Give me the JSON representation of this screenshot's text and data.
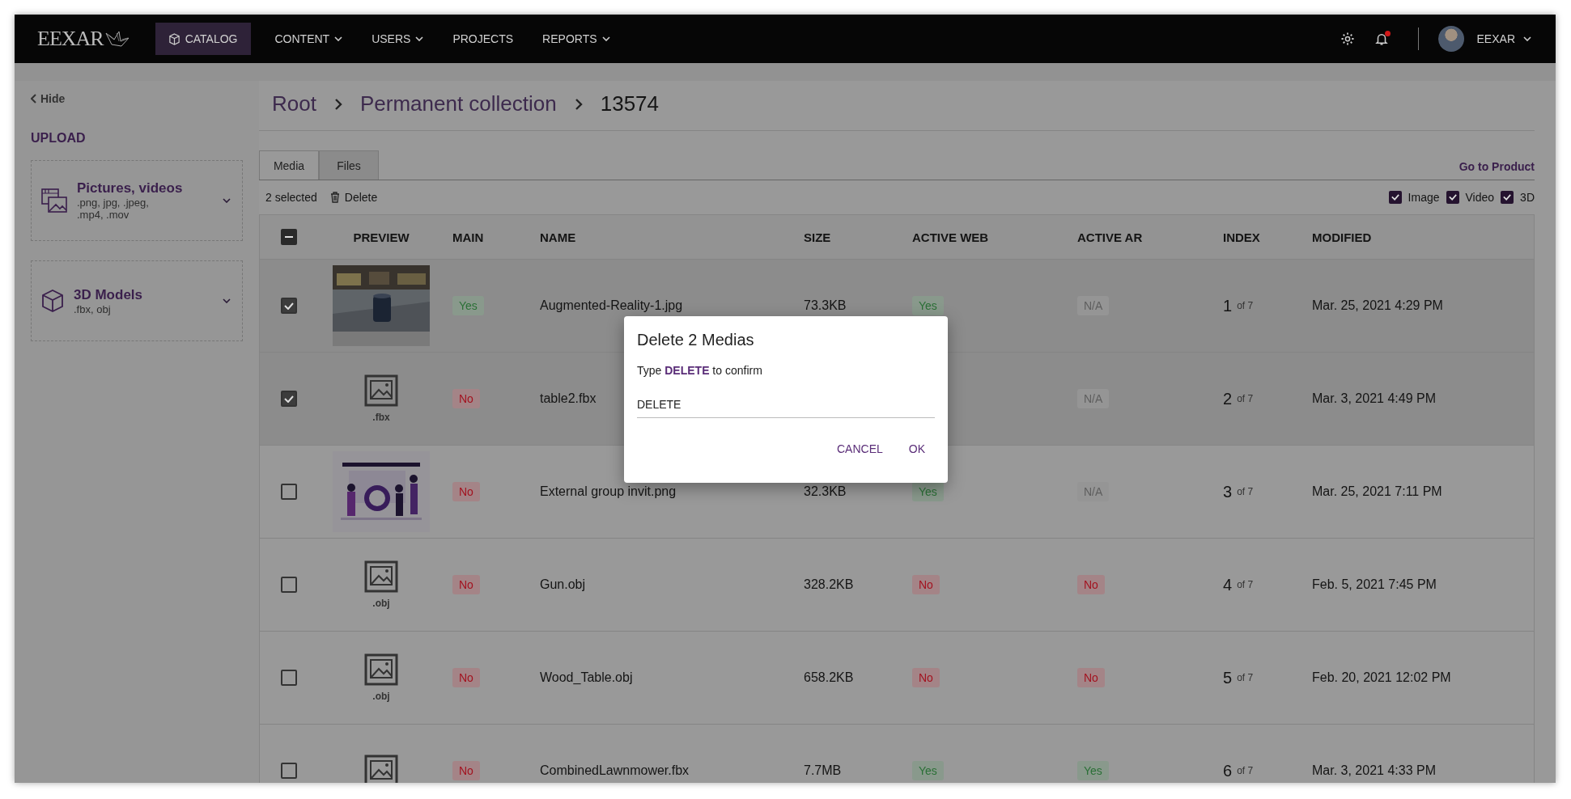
{
  "header": {
    "logo": "EEXAR",
    "nav": [
      {
        "label": "CATALOG",
        "selected": true,
        "has_menu": false
      },
      {
        "label": "CONTENT",
        "selected": false,
        "has_menu": true
      },
      {
        "label": "USERS",
        "selected": false,
        "has_menu": true
      },
      {
        "label": "PROJECTS",
        "selected": false,
        "has_menu": false
      },
      {
        "label": "REPORTS",
        "selected": false,
        "has_menu": true
      }
    ],
    "notification_dot": true,
    "user": "EEXAR"
  },
  "sidebar": {
    "hide": "Hide",
    "title": "UPLOAD",
    "uploads": [
      {
        "kind": "media",
        "title": "Pictures, videos",
        "formats": ".png, jpg, .jpeg, .mp4, .mov"
      },
      {
        "kind": "model",
        "title": "3D Models",
        "formats": ".fbx, obj"
      }
    ]
  },
  "breadcrumb": [
    "Root",
    "Permanent collection",
    "13574"
  ],
  "tabs": [
    {
      "label": "Media",
      "selected": true
    },
    {
      "label": "Files",
      "selected": false
    }
  ],
  "go_to_product": "Go to Product",
  "toolbar": {
    "selected_count": "2 selected",
    "delete": "Delete",
    "filters": [
      {
        "label": "Image",
        "checked": true
      },
      {
        "label": "Video",
        "checked": true
      },
      {
        "label": "3D",
        "checked": true
      }
    ]
  },
  "table": {
    "select_all_partial": true,
    "columns": [
      "PREVIEW",
      "MAIN",
      "NAME",
      "SIZE",
      "ACTIVE WEB",
      "ACTIVE AR",
      "INDEX",
      "MODIFIED"
    ],
    "rows": [
      {
        "selected": true,
        "main": {
          "label": "Yes",
          "color": "#2a7036"
        },
        "name": "Augmented-Reality-1.jpg",
        "size": "73.3KB",
        "active_web": {
          "label": "Yes",
          "color": "#2a7036"
        },
        "active_ar": {
          "label": "N/A",
          "color": "#5e5e5e"
        },
        "index": "1",
        "index_total": "of 7",
        "modified": "Mar. 25, 2021 4:29 PM"
      },
      {
        "selected": true,
        "preview": {
          "kind": "file",
          "ext": ".fbx"
        },
        "main": {
          "label": "No",
          "color": "#a3121f"
        },
        "name": "table2.fbx",
        "active_ar": {
          "label": "N/A",
          "color": "#5e5e5e"
        },
        "index": "2",
        "index_total": "of 7",
        "modified": "Mar. 3, 2021 4:49 PM"
      },
      {
        "selected": false,
        "preview": {
          "kind": "illustration"
        },
        "main": {
          "label": "No",
          "color": "#a3121f"
        },
        "name": "External group invit.png",
        "size": "32.3KB",
        "active_web": {
          "label": "Yes",
          "color": "#2a7036"
        },
        "active_ar": {
          "label": "N/A",
          "color": "#5e5e5e"
        },
        "index": "3",
        "index_total": "of 7",
        "modified": "Mar. 25, 2021 7:11 PM"
      },
      {
        "selected": false,
        "preview": {
          "kind": "file",
          "ext": ".obj"
        },
        "main": {
          "label": "No",
          "color": "#a3121f"
        },
        "name": "Gun.obj",
        "size": "328.2KB",
        "active_web": {
          "label": "No",
          "color": "#a3121f"
        },
        "active_ar": {
          "label": "No",
          "color": "#a3121f"
        },
        "index": "4",
        "index_total": "of 7",
        "modified": "Feb. 5, 2021 7:45 PM"
      },
      {
        "selected": false,
        "preview": {
          "kind": "file",
          "ext": ".obj"
        },
        "main": {
          "label": "No",
          "color": "#a3121f"
        },
        "name": "Wood_Table.obj",
        "size": "658.2KB",
        "active_web": {
          "label": "No",
          "color": "#a3121f"
        },
        "active_ar": {
          "label": "No",
          "color": "#a3121f"
        },
        "index": "5",
        "index_total": "of 7",
        "modified": "Feb. 20, 2021 12:02 PM"
      },
      {
        "selected": false,
        "preview": {
          "kind": "file"
        },
        "main": {
          "label": "No",
          "color": "#a3121f"
        },
        "name": "CombinedLawnmower.fbx",
        "size": "7.7MB",
        "active_web": {
          "label": "Yes",
          "color": "#2a7036"
        },
        "active_ar": {
          "label": "Yes",
          "color": "#2a7036"
        },
        "index": "6",
        "index_total": "of 7",
        "modified": "Mar. 3, 2021 4:33 PM"
      }
    ]
  },
  "dialog": {
    "title": "Delete 2 Medias",
    "instruction": "Type **DELETE** to confirm",
    "value": "DELETE",
    "buttons": [
      "CANCEL",
      "OK"
    ]
  }
}
